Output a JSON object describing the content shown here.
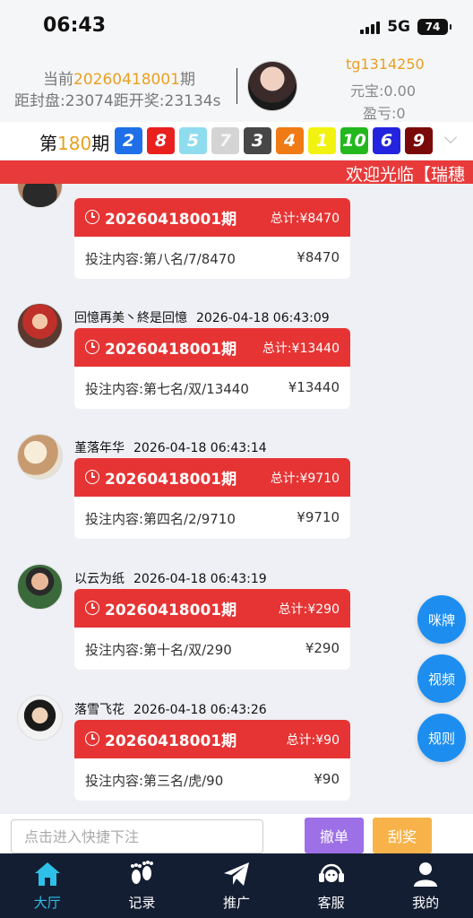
{
  "status": {
    "time": "06:43",
    "network": "5G",
    "battery": "74"
  },
  "header": {
    "period_prefix": "当前",
    "period_number": "20260418001",
    "period_suffix": "期",
    "countdown": "距封盘:23074距开奖:23134s",
    "username": "tg1314250",
    "yuanbao": "元宝:0.00",
    "yingkui": "盈亏:0"
  },
  "result": {
    "prefix": "第",
    "issue": "180",
    "suffix": "期",
    "balls": [
      {
        "num": "2",
        "color": "#1e6fe8"
      },
      {
        "num": "8",
        "color": "#e8201e"
      },
      {
        "num": "5",
        "color": "#8fdcef"
      },
      {
        "num": "7",
        "color": "#d4d4d4"
      },
      {
        "num": "3",
        "color": "#474747"
      },
      {
        "num": "4",
        "color": "#f07a14"
      },
      {
        "num": "1",
        "color": "#f2f210"
      },
      {
        "num": "10",
        "color": "#22b81e"
      },
      {
        "num": "6",
        "color": "#2424e0"
      },
      {
        "num": "9",
        "color": "#7a0a0a"
      }
    ]
  },
  "marquee": "欢迎光临【瑞穗",
  "bets": [
    {
      "user": "",
      "time": "",
      "issue": "20260418001期",
      "total_label": "总计:",
      "total": "¥8470",
      "content": "投注内容:第八名/7/8470",
      "amount": "¥8470"
    },
    {
      "user": "回憶再美丶終是回憶",
      "time": "2026-04-18 06:43:09",
      "issue": "20260418001期",
      "total_label": "总计:",
      "total": "¥13440",
      "content": "投注内容:第七名/双/13440",
      "amount": "¥13440"
    },
    {
      "user": "堇落年华",
      "time": "2026-04-18 06:43:14",
      "issue": "20260418001期",
      "total_label": "总计:",
      "total": "¥9710",
      "content": "投注内容:第四名/2/9710",
      "amount": "¥9710"
    },
    {
      "user": "以云为纸",
      "time": "2026-04-18 06:43:19",
      "issue": "20260418001期",
      "total_label": "总计:",
      "total": "¥290",
      "content": "投注内容:第十名/双/290",
      "amount": "¥290"
    },
    {
      "user": "落雪飞花",
      "time": "2026-04-18 06:43:26",
      "issue": "20260418001期",
      "total_label": "总计:",
      "total": "¥90",
      "content": "投注内容:第三名/虎/90",
      "amount": "¥90"
    }
  ],
  "fabs": {
    "cards": "咪牌",
    "video": "视频",
    "rules": "规则"
  },
  "quick": {
    "placeholder": "点击进入快捷下注",
    "undo": "撤单",
    "scratch": "刮奖"
  },
  "tabs": {
    "hall": "大厅",
    "records": "记录",
    "promote": "推广",
    "service": "客服",
    "mine": "我的"
  },
  "colors": {
    "accent_red": "#e63434",
    "highlight_orange": "#e8a020",
    "tab_active": "#2ec0e8",
    "tabbar_bg": "#141e33"
  }
}
